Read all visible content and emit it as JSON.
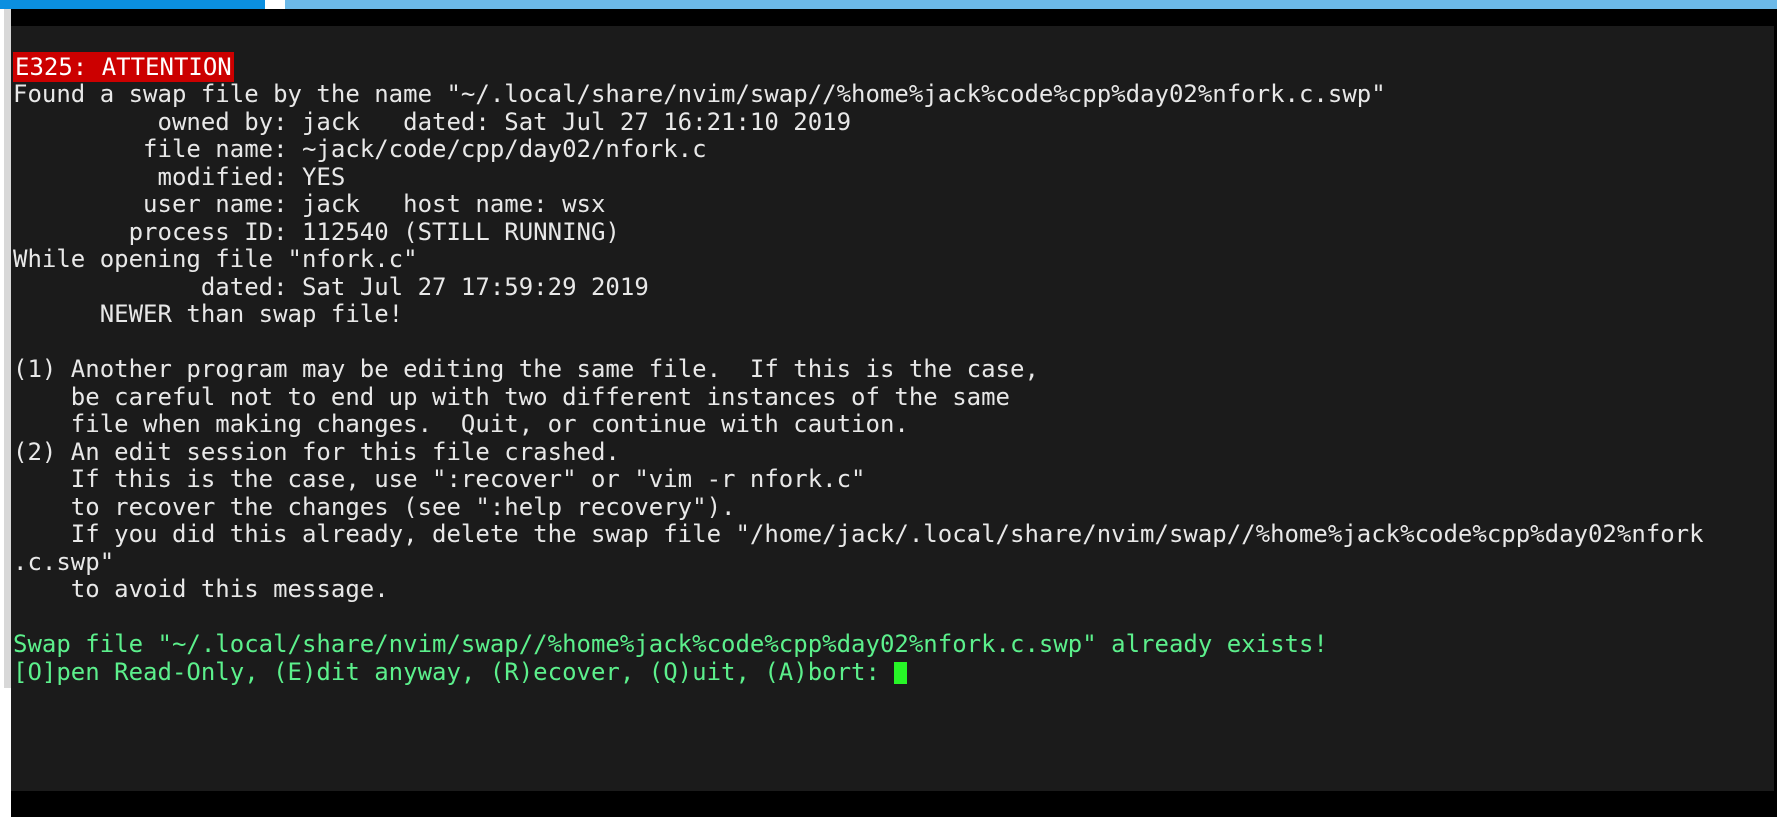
{
  "window": {
    "type": "terminal-emulator",
    "progress_bar": {
      "filled_color": "#0b8fe0",
      "track_color": "#6cb9e8"
    },
    "background": "#1b1b1b",
    "foreground": "#e8e8e8",
    "error_highlight_bg": "#cc0000",
    "error_highlight_fg": "#ffffff",
    "prompt_color": "#5cf08c",
    "cursor_color": "#27f527"
  },
  "terminal": {
    "error_code_label": "E325: ATTENTION",
    "lines": [
      {
        "id": "blank-top-1",
        "text": "",
        "style": "normal"
      },
      {
        "id": "attention-header",
        "text": "E325: ATTENTION",
        "style": "attention"
      },
      {
        "id": "found-swap",
        "text": "Found a swap file by the name \"~/.local/share/nvim/swap//%home%jack%code%cpp%day02%nfork.c.swp\"",
        "style": "normal"
      },
      {
        "id": "owned-by",
        "text": "          owned by: jack   dated: Sat Jul 27 16:21:10 2019",
        "style": "normal"
      },
      {
        "id": "file-name",
        "text": "         file name: ~jack/code/cpp/day02/nfork.c",
        "style": "normal"
      },
      {
        "id": "modified",
        "text": "          modified: YES",
        "style": "normal"
      },
      {
        "id": "user-name",
        "text": "         user name: jack   host name: wsx",
        "style": "normal"
      },
      {
        "id": "process-id",
        "text": "        process ID: 112540 (STILL RUNNING)",
        "style": "normal"
      },
      {
        "id": "while-opening",
        "text": "While opening file \"nfork.c\"",
        "style": "normal"
      },
      {
        "id": "dated-file",
        "text": "             dated: Sat Jul 27 17:59:29 2019",
        "style": "normal"
      },
      {
        "id": "newer-than",
        "text": "      NEWER than swap file!",
        "style": "normal"
      },
      {
        "id": "blank-1",
        "text": "",
        "style": "normal"
      },
      {
        "id": "reason-1-a",
        "text": "(1) Another program may be editing the same file.  If this is the case,",
        "style": "normal"
      },
      {
        "id": "reason-1-b",
        "text": "    be careful not to end up with two different instances of the same",
        "style": "normal"
      },
      {
        "id": "reason-1-c",
        "text": "    file when making changes.  Quit, or continue with caution.",
        "style": "normal"
      },
      {
        "id": "reason-2-a",
        "text": "(2) An edit session for this file crashed.",
        "style": "normal"
      },
      {
        "id": "reason-2-b",
        "text": "    If this is the case, use \":recover\" or \"vim -r nfork.c\"",
        "style": "normal"
      },
      {
        "id": "reason-2-c",
        "text": "    to recover the changes (see \":help recovery\").",
        "style": "normal"
      },
      {
        "id": "reason-2-d",
        "text": "    If you did this already, delete the swap file \"/home/jack/.local/share/nvim/swap//%home%jack%code%cpp%day02%nfork",
        "style": "normal"
      },
      {
        "id": "reason-2-e",
        "text": ".c.swp\"",
        "style": "normal"
      },
      {
        "id": "reason-2-f",
        "text": "    to avoid this message.",
        "style": "normal"
      },
      {
        "id": "blank-2",
        "text": "",
        "style": "normal"
      },
      {
        "id": "swap-exists",
        "text": "Swap file \"~/.local/share/nvim/swap//%home%jack%code%cpp%day02%nfork.c.swp\" already exists!",
        "style": "green"
      },
      {
        "id": "prompt-options",
        "text": "[O]pen Read-Only, (E)dit anyway, (R)ecover, (Q)uit, (A)bort: ",
        "style": "green-cursor"
      }
    ],
    "prompt": {
      "options": [
        {
          "key": "O",
          "label": "[O]pen Read-Only"
        },
        {
          "key": "E",
          "label": "(E)dit anyway"
        },
        {
          "key": "R",
          "label": "(R)ecover"
        },
        {
          "key": "Q",
          "label": "(Q)uit"
        },
        {
          "key": "A",
          "label": "(A)bort"
        }
      ],
      "cursor_visible": true
    },
    "swap_info": {
      "swap_file_path": "~/.local/share/nvim/swap//%home%jack%code%cpp%day02%nfork.c.swp",
      "owned_by": "jack",
      "swap_dated": "Sat Jul 27 16:21:10 2019",
      "file_name": "~jack/code/cpp/day02/nfork.c",
      "modified": "YES",
      "user_name": "jack",
      "host_name": "wsx",
      "process_id": "112540",
      "process_state": "STILL RUNNING",
      "opening_file": "nfork.c",
      "file_dated": "Sat Jul 27 17:59:29 2019",
      "relation": "NEWER than swap file!",
      "absolute_swap_path": "/home/jack/.local/share/nvim/swap//%home%jack%code%cpp%day02%nfork.c.swp"
    }
  }
}
